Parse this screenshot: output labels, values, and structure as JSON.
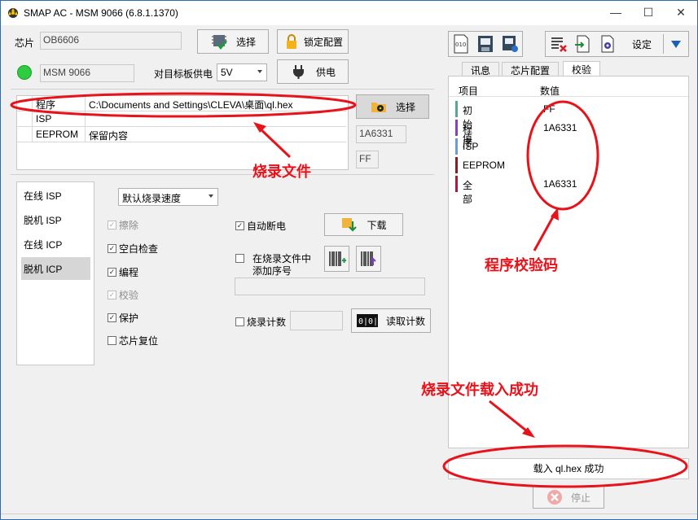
{
  "window": {
    "title": "SMAP AC - MSM 9066  (6.8.1.1370)"
  },
  "chip": {
    "label": "芯片",
    "value": "OB6606",
    "select_label": "选择",
    "lock_label": "锁定配置"
  },
  "device": {
    "value": "MSM 9066",
    "power_label": "对目标板供电",
    "voltage": "5V",
    "supply_label": "供电"
  },
  "program_file": {
    "rows": [
      {
        "name": "程序",
        "value": "C:\\Documents and Settings\\CLEVA\\桌面\\ql.hex"
      },
      {
        "name": "ISP",
        "value": ""
      },
      {
        "name": "EEPROM",
        "value": "保留内容"
      }
    ],
    "select_label": "选择",
    "checksum": "1A6331",
    "eeprom_fill": "FF"
  },
  "modes": {
    "items": [
      "在线 ISP",
      "脱机 ISP",
      "在线 ICP",
      "脱机 ICP"
    ],
    "selected": "脱机 ICP"
  },
  "speed": {
    "value": "默认烧录速度"
  },
  "options": {
    "erase": "擦除",
    "blank_check": "空白检查",
    "program": "编程",
    "verify": "校验",
    "protect": "保护",
    "chip_reset": "芯片复位"
  },
  "actions": {
    "auto_power_off": "自动断电",
    "download": "下载",
    "add_serial_line1": "在烧录文件中",
    "add_serial_line2": "添加序号",
    "burn_count": "烧录计数",
    "read_count": "读取计数"
  },
  "toolbar": {
    "settings_label": "设定"
  },
  "tabs": [
    "讯息",
    "芯片配置",
    "校验"
  ],
  "checksum_panel": {
    "col_item": "项目",
    "col_value": "数值",
    "rows": [
      {
        "name": "初始值",
        "value": "FF",
        "color": "#5aa59a"
      },
      {
        "name": "程序",
        "value": "1A6331",
        "color": "#8a3fc2"
      },
      {
        "name": "ISP",
        "value": "",
        "color": "#6a9bd8"
      },
      {
        "name": "EEPROM",
        "value": "",
        "color": "#8a1f1f"
      },
      {
        "name": "全部",
        "value": "1A6331",
        "color": "#b01a3a"
      }
    ]
  },
  "status": {
    "message": "载入 ql.hex 成功",
    "stop_label": "停止"
  },
  "annotations": {
    "file": "烧录文件",
    "checksum": "程序校验码",
    "loaded": "烧录文件载入成功"
  },
  "colors": {
    "annotation": "#e8121b",
    "status_ok": "#2ecc40"
  }
}
